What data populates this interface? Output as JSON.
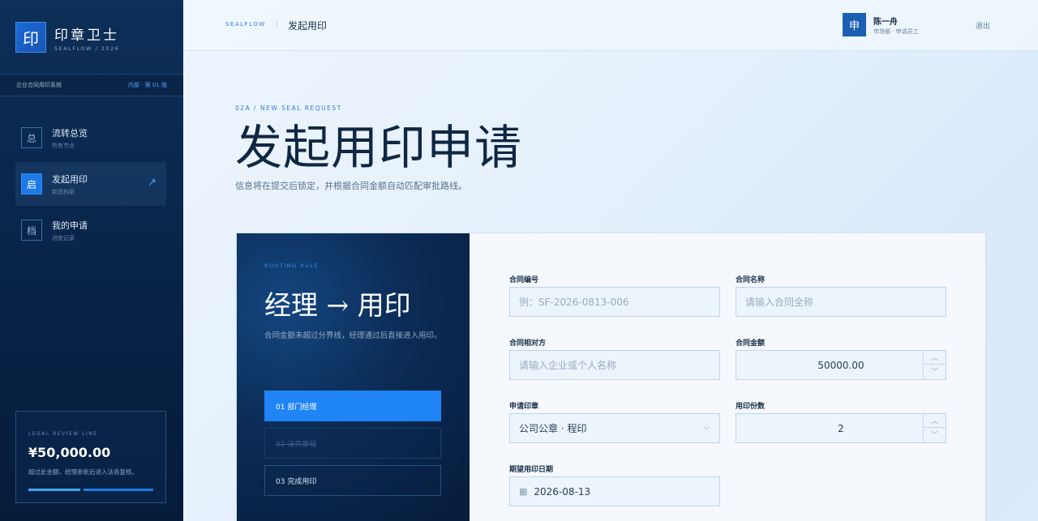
{
  "brand": {
    "mark": "印",
    "title": "印章卫士",
    "sub": "SEALFLOW / 2026"
  },
  "system": {
    "name": "企业合同用印系统",
    "badge": "内部 · 第 01 版"
  },
  "nav": [
    {
      "icon": "总",
      "title": "流转总览",
      "sub": "所有节点",
      "active": false
    },
    {
      "icon": "启",
      "title": "发起用印",
      "sub": "新建档案",
      "active": true,
      "arrow": "↗"
    },
    {
      "icon": "档",
      "title": "我的申请",
      "sub": "进度记录",
      "active": false
    }
  ],
  "legal": {
    "label": "LEGAL REVIEW LINE",
    "amount": "¥50,000.00",
    "note": "超过此金额，经理审批后进入法务复核。",
    "bar_colors": [
      "#3fa6ff",
      "#1f7ae6"
    ]
  },
  "topbar": {
    "brand": "SEALFLOW",
    "title": "发起用印",
    "logout": "退出"
  },
  "user": {
    "avatar": "申",
    "name": "陈一舟",
    "dept": "市场部 · 申请员工"
  },
  "page": {
    "eyebrow": "02A / NEW SEAL REQUEST",
    "title": "发起用印申请",
    "desc": "信息将在提交后锁定，并根据合同金额自动匹配审批路线。"
  },
  "rule": {
    "label": "ROUTING RULE",
    "title": "经理 → 用印",
    "desc": "合同金额未超过分界线，经理通过后直接进入用印。",
    "steps": [
      "01 部门经理",
      "02 法务复核",
      "03 完成用印"
    ]
  },
  "form": {
    "contract_no": {
      "label": "合同编号",
      "placeholder": "例：SF-2026-0813-006"
    },
    "contract_name": {
      "label": "合同名称",
      "placeholder": "请输入合同全称"
    },
    "counterparty": {
      "label": "合同相对方",
      "placeholder": "请输入企业或个人名称"
    },
    "amount": {
      "label": "合同金额",
      "value": "50000.00"
    },
    "seal": {
      "label": "申请印章",
      "value": "公司公章 · 程印"
    },
    "copies": {
      "label": "用印份数",
      "value": "2"
    },
    "date": {
      "label": "期望用印日期",
      "value": "2026-08-13"
    }
  },
  "colors": {
    "accent": "#1f84f5",
    "sidebar": "#082347",
    "title": "#0f2743"
  }
}
